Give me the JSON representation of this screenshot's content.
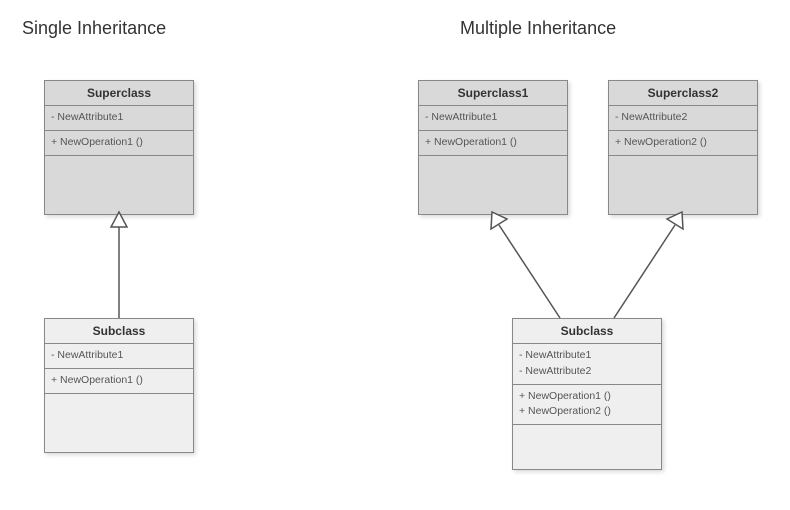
{
  "titles": {
    "single": "Single Inheritance",
    "multiple": "Multiple Inheritance"
  },
  "single": {
    "super": {
      "name": "Superclass",
      "attr": "- NewAttribute1",
      "op": "+ NewOperation1 ()"
    },
    "sub": {
      "name": "Subclass",
      "attr": "- NewAttribute1",
      "op": "+ NewOperation1 ()"
    }
  },
  "multiple": {
    "super1": {
      "name": "Superclass1",
      "attr": "- NewAttribute1",
      "op": "+ NewOperation1 ()"
    },
    "super2": {
      "name": "Superclass2",
      "attr": "- NewAttribute2",
      "op": "+ NewOperation2 ()"
    },
    "sub": {
      "name": "Subclass",
      "attr1": "- NewAttribute1",
      "attr2": "- NewAttribute2",
      "op1": "+ NewOperation1 ()",
      "op2": "+ NewOperation2 ()"
    }
  },
  "chart_data": [
    {
      "type": "diagram",
      "title": "Single Inheritance",
      "classes": [
        {
          "name": "Superclass",
          "attributes": [
            "- NewAttribute1"
          ],
          "operations": [
            "+ NewOperation1 ()"
          ]
        },
        {
          "name": "Subclass",
          "attributes": [
            "- NewAttribute1"
          ],
          "operations": [
            "+ NewOperation1 ()"
          ]
        }
      ],
      "inheritance": [
        {
          "child": "Subclass",
          "parent": "Superclass"
        }
      ]
    },
    {
      "type": "diagram",
      "title": "Multiple Inheritance",
      "classes": [
        {
          "name": "Superclass1",
          "attributes": [
            "- NewAttribute1"
          ],
          "operations": [
            "+ NewOperation1 ()"
          ]
        },
        {
          "name": "Superclass2",
          "attributes": [
            "- NewAttribute2"
          ],
          "operations": [
            "+ NewOperation2 ()"
          ]
        },
        {
          "name": "Subclass",
          "attributes": [
            "- NewAttribute1",
            "- NewAttribute2"
          ],
          "operations": [
            "+ NewOperation1 ()",
            "+ NewOperation2 ()"
          ]
        }
      ],
      "inheritance": [
        {
          "child": "Subclass",
          "parent": "Superclass1"
        },
        {
          "child": "Subclass",
          "parent": "Superclass2"
        }
      ]
    }
  ]
}
